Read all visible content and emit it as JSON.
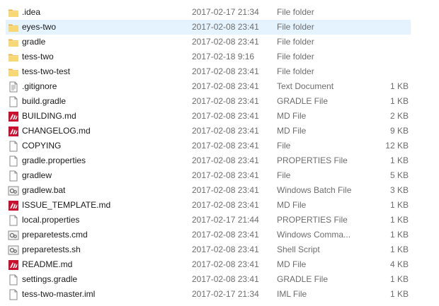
{
  "files": [
    {
      "name": ".idea",
      "date": "2017-02-17 21:34",
      "type": "File folder",
      "size": "",
      "icon": "folder-icon"
    },
    {
      "name": "eyes-two",
      "date": "2017-02-08 23:41",
      "type": "File folder",
      "size": "",
      "icon": "folder-icon",
      "selected": true
    },
    {
      "name": "gradle",
      "date": "2017-02-08 23:41",
      "type": "File folder",
      "size": "",
      "icon": "folder-icon"
    },
    {
      "name": "tess-two",
      "date": "2017-02-18 9:16",
      "type": "File folder",
      "size": "",
      "icon": "folder-icon"
    },
    {
      "name": "tess-two-test",
      "date": "2017-02-08 23:41",
      "type": "File folder",
      "size": "",
      "icon": "folder-icon"
    },
    {
      "name": ".gitignore",
      "date": "2017-02-08 23:41",
      "type": "Text Document",
      "size": "1 KB",
      "icon": "text-document-icon"
    },
    {
      "name": "build.gradle",
      "date": "2017-02-08 23:41",
      "type": "GRADLE File",
      "size": "1 KB",
      "icon": "generic-file-icon"
    },
    {
      "name": "BUILDING.md",
      "date": "2017-02-08 23:41",
      "type": "MD File",
      "size": "2 KB",
      "icon": "markdown-file-icon"
    },
    {
      "name": "CHANGELOG.md",
      "date": "2017-02-08 23:41",
      "type": "MD File",
      "size": "9 KB",
      "icon": "markdown-file-icon"
    },
    {
      "name": "COPYING",
      "date": "2017-02-08 23:41",
      "type": "File",
      "size": "12 KB",
      "icon": "generic-file-icon"
    },
    {
      "name": "gradle.properties",
      "date": "2017-02-08 23:41",
      "type": "PROPERTIES File",
      "size": "1 KB",
      "icon": "generic-file-icon"
    },
    {
      "name": "gradlew",
      "date": "2017-02-08 23:41",
      "type": "File",
      "size": "5 KB",
      "icon": "generic-file-icon"
    },
    {
      "name": "gradlew.bat",
      "date": "2017-02-08 23:41",
      "type": "Windows Batch File",
      "size": "3 KB",
      "icon": "batch-file-icon"
    },
    {
      "name": "ISSUE_TEMPLATE.md",
      "date": "2017-02-08 23:41",
      "type": "MD File",
      "size": "1 KB",
      "icon": "markdown-file-icon"
    },
    {
      "name": "local.properties",
      "date": "2017-02-17 21:44",
      "type": "PROPERTIES File",
      "size": "1 KB",
      "icon": "generic-file-icon"
    },
    {
      "name": "preparetests.cmd",
      "date": "2017-02-08 23:41",
      "type": "Windows Comma...",
      "size": "1 KB",
      "icon": "batch-file-icon"
    },
    {
      "name": "preparetests.sh",
      "date": "2017-02-08 23:41",
      "type": "Shell Script",
      "size": "1 KB",
      "icon": "batch-file-icon"
    },
    {
      "name": "README.md",
      "date": "2017-02-08 23:41",
      "type": "MD File",
      "size": "4 KB",
      "icon": "markdown-file-icon"
    },
    {
      "name": "settings.gradle",
      "date": "2017-02-08 23:41",
      "type": "GRADLE File",
      "size": "1 KB",
      "icon": "generic-file-icon"
    },
    {
      "name": "tess-two-master.iml",
      "date": "2017-02-17 21:34",
      "type": "IML File",
      "size": "1 KB",
      "icon": "generic-file-icon"
    }
  ],
  "colors": {
    "selection_bg": "#e5f3ff",
    "folder_yellow": "#f8d775",
    "markdown_red": "#c8102e",
    "secondary_text": "#6d6d6d"
  }
}
